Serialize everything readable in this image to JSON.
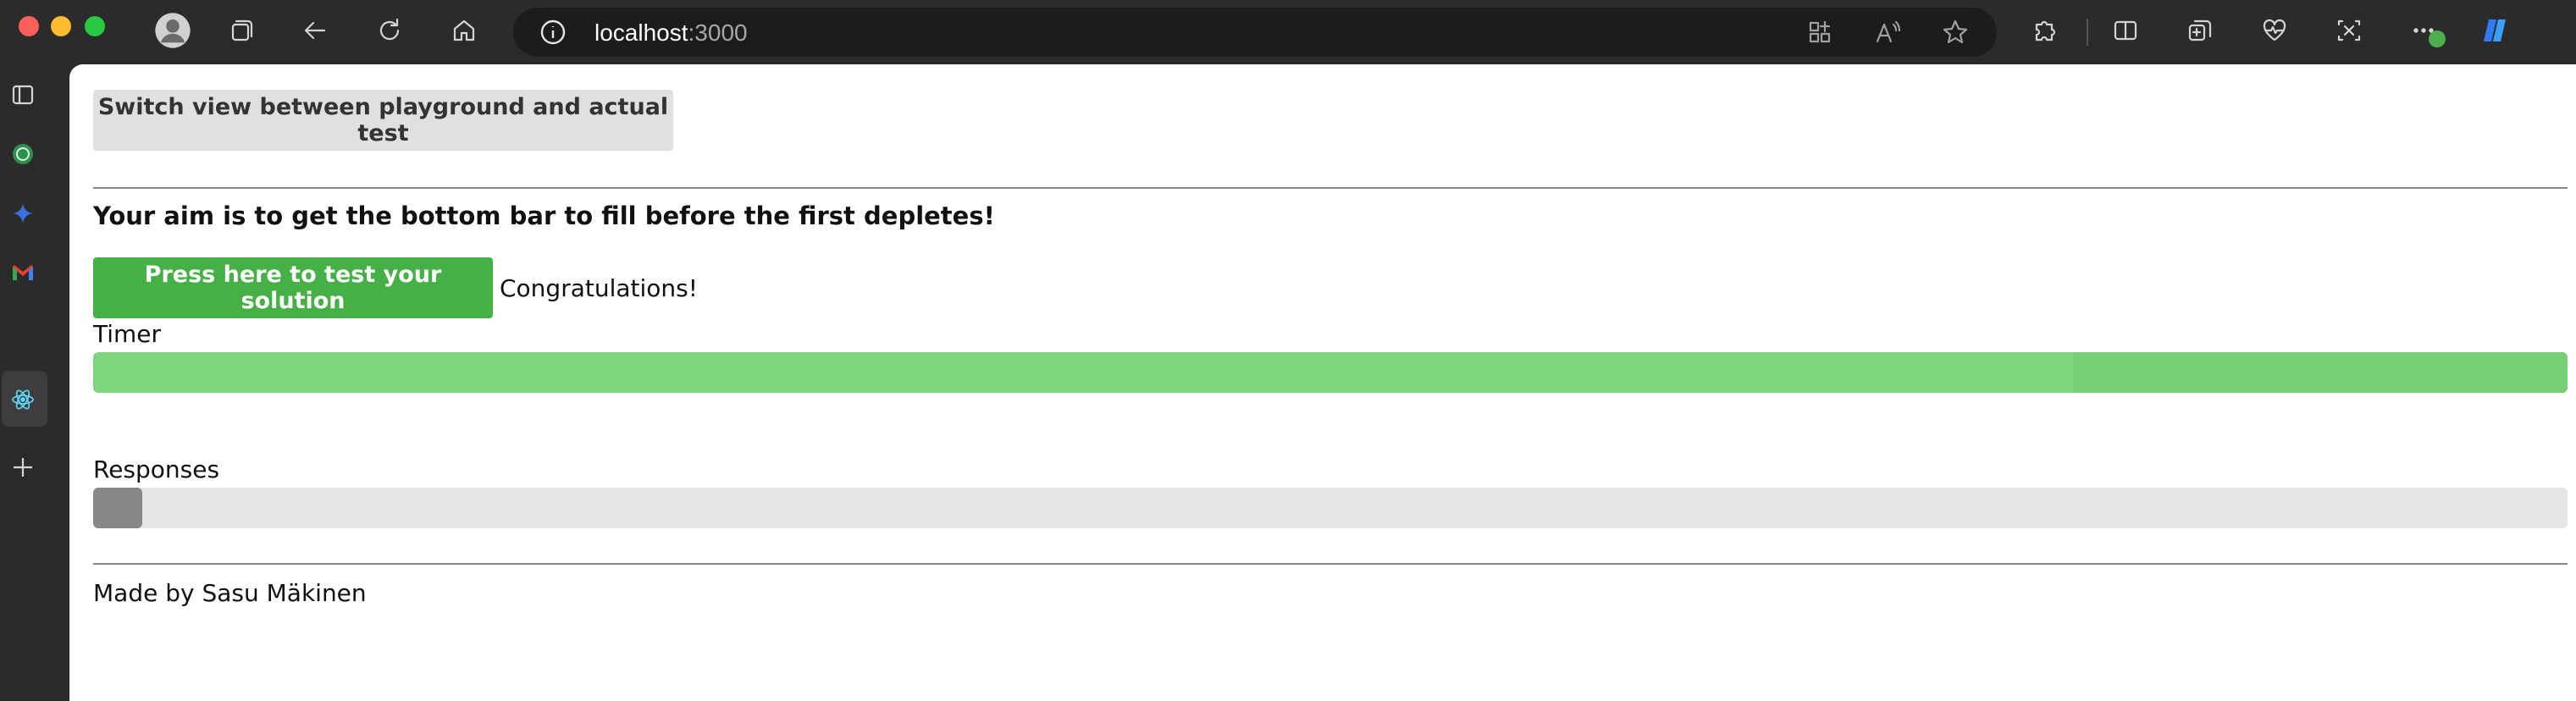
{
  "browser": {
    "url_host": "localhost",
    "url_port": ":3000",
    "icons": {
      "profile": "profile-avatar-icon",
      "workspaces": "workspaces-icon",
      "back": "back-arrow-icon",
      "refresh": "refresh-icon",
      "home": "home-icon",
      "site_info": "info-icon",
      "apps": "apps-icon",
      "read_aloud": "read-aloud-icon",
      "favorite": "star-icon",
      "extensions": "puzzle-icon",
      "split_screen": "split-screen-icon",
      "collections": "collections-icon",
      "browser_essentials": "heartbeat-icon",
      "screenshot": "screenshot-icon",
      "more": "more-icon",
      "copilot": "copilot-icon"
    }
  },
  "sidebar": {
    "items": [
      {
        "name": "tab-actions-icon"
      },
      {
        "name": "whatsapp-icon"
      },
      {
        "name": "sparkle-icon"
      },
      {
        "name": "gmail-icon"
      },
      {
        "name": "react-icon"
      },
      {
        "name": "add-icon"
      }
    ]
  },
  "page": {
    "switch_button": "Switch view between playground and actual test",
    "aim_text": "Your aim is to get the bottom bar to fill before the first depletes!",
    "test_button": "Press here to test your solution",
    "status_text": "Congratulations!",
    "timer_label": "Timer",
    "timer_progress": 1.0,
    "responses_label": "Responses",
    "responses_progress": 0.02,
    "footer_text": "Made by Sasu Mäkinen"
  },
  "colors": {
    "accent_green": "#45b045",
    "timer_bar": "#7ed67e",
    "responses_bar": "#888888",
    "track": "#e6e6e6"
  }
}
